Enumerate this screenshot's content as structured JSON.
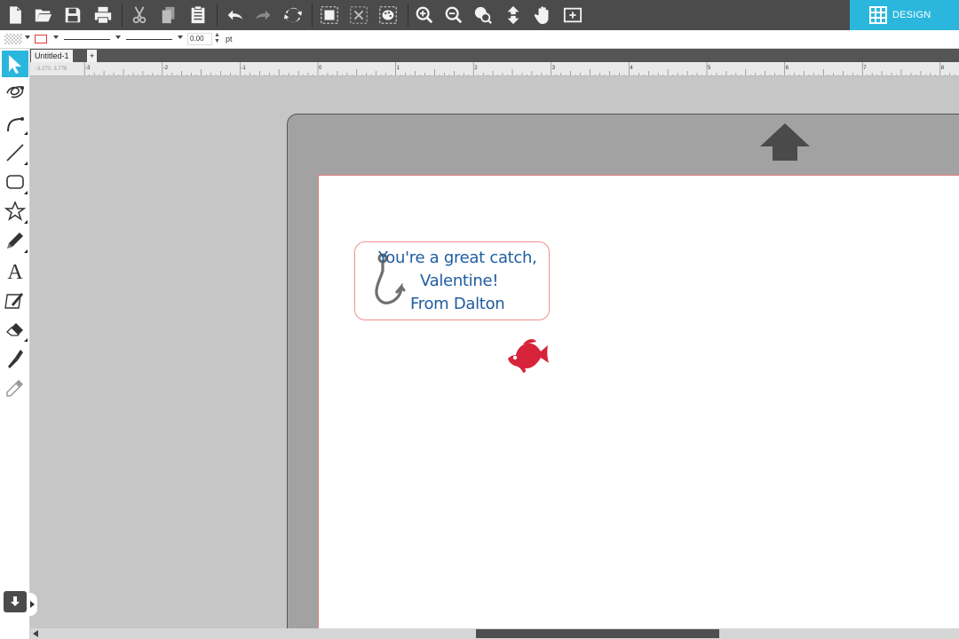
{
  "toolbar": {
    "buttons": [
      {
        "name": "new-document-icon"
      },
      {
        "name": "open-folder-icon"
      },
      {
        "name": "save-icon"
      },
      {
        "name": "print-icon"
      },
      {
        "name": "cut-icon"
      },
      {
        "name": "copy-icon"
      },
      {
        "name": "paste-icon"
      },
      {
        "name": "undo-icon"
      },
      {
        "name": "redo-icon"
      },
      {
        "name": "redraw-icon"
      },
      {
        "name": "group-icon"
      },
      {
        "name": "ungroup-icon"
      },
      {
        "name": "fill-pattern-icon"
      },
      {
        "name": "zoom-in-icon"
      },
      {
        "name": "zoom-out-icon"
      },
      {
        "name": "zoom-selection-icon"
      },
      {
        "name": "drag-zoom-icon"
      },
      {
        "name": "pan-hand-icon"
      },
      {
        "name": "fit-to-page-icon"
      }
    ],
    "design_label": "DESIGN",
    "design_color": "#2bb7dd"
  },
  "subbar": {
    "line_width_value": "0.00",
    "line_width_unit": "pt",
    "line_color": "#e03a3a"
  },
  "tabs": [
    {
      "label": "Untitled-1"
    },
    {
      "label": "+"
    }
  ],
  "ruler": {
    "readout": "-3.270, 3.776",
    "labels": [
      "-3",
      "-2",
      "-1",
      "0",
      "1",
      "2",
      "3",
      "4",
      "5",
      "6",
      "7",
      "8"
    ]
  },
  "tools": [
    {
      "name": "select-arrow-icon",
      "active": true
    },
    {
      "name": "point-edit-icon"
    },
    {
      "name": "bezier-curve-icon"
    },
    {
      "name": "line-tool-icon"
    },
    {
      "name": "rectangle-tool-icon"
    },
    {
      "name": "star-polygon-icon"
    },
    {
      "name": "pencil-icon"
    },
    {
      "name": "text-tool-icon"
    },
    {
      "name": "sketch-pad-icon"
    },
    {
      "name": "eraser-icon"
    },
    {
      "name": "knife-icon"
    },
    {
      "name": "eyedropper-icon"
    }
  ],
  "label": {
    "line1": "You're a great catch,",
    "line2": "Valentine!",
    "line3": "From Dalton",
    "text_color": "#1f5ca0",
    "border_color": "#f08f8f",
    "hook_color": "#6f6f6f",
    "fish_color": "#d8243a"
  }
}
